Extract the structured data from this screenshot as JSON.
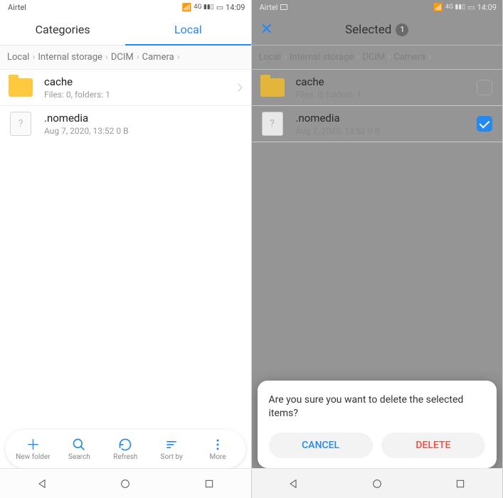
{
  "status": {
    "carrier": "Airtel",
    "time": "14:09",
    "wifi": "📶",
    "signal": "⁴ᴳ ᎒᎒Ⅰ",
    "battery": "▮▯"
  },
  "left": {
    "tabs": {
      "categories": "Categories",
      "local": "Local"
    },
    "crumbs": [
      "Local",
      "Internal storage",
      "DCIM",
      "Camera"
    ],
    "rows": [
      {
        "name": "cache",
        "sub": "Files: 0, folders: 1",
        "kind": "folder"
      },
      {
        "name": ".nomedia",
        "sub": "Aug 7, 2020, 13:52 0 B",
        "kind": "file"
      }
    ],
    "toolbar": {
      "new": "New folder",
      "search": "Search",
      "refresh": "Refresh",
      "sort": "Sort by",
      "more": "More"
    }
  },
  "right": {
    "header": {
      "title": "Selected",
      "count": "1"
    },
    "crumbs": [
      "Local",
      "Internal storage",
      "DCIM",
      "Camera"
    ],
    "rows": [
      {
        "name": "cache",
        "sub": "Files: 0, folders: 1",
        "kind": "folder",
        "checked": false
      },
      {
        "name": ".nomedia",
        "sub": "Aug 7, 2020, 13:52 0 B",
        "kind": "file",
        "checked": true
      }
    ],
    "dialog": {
      "message": "Are you sure you want to delete the selected items?",
      "cancel": "CANCEL",
      "delete": "DELETE"
    }
  }
}
